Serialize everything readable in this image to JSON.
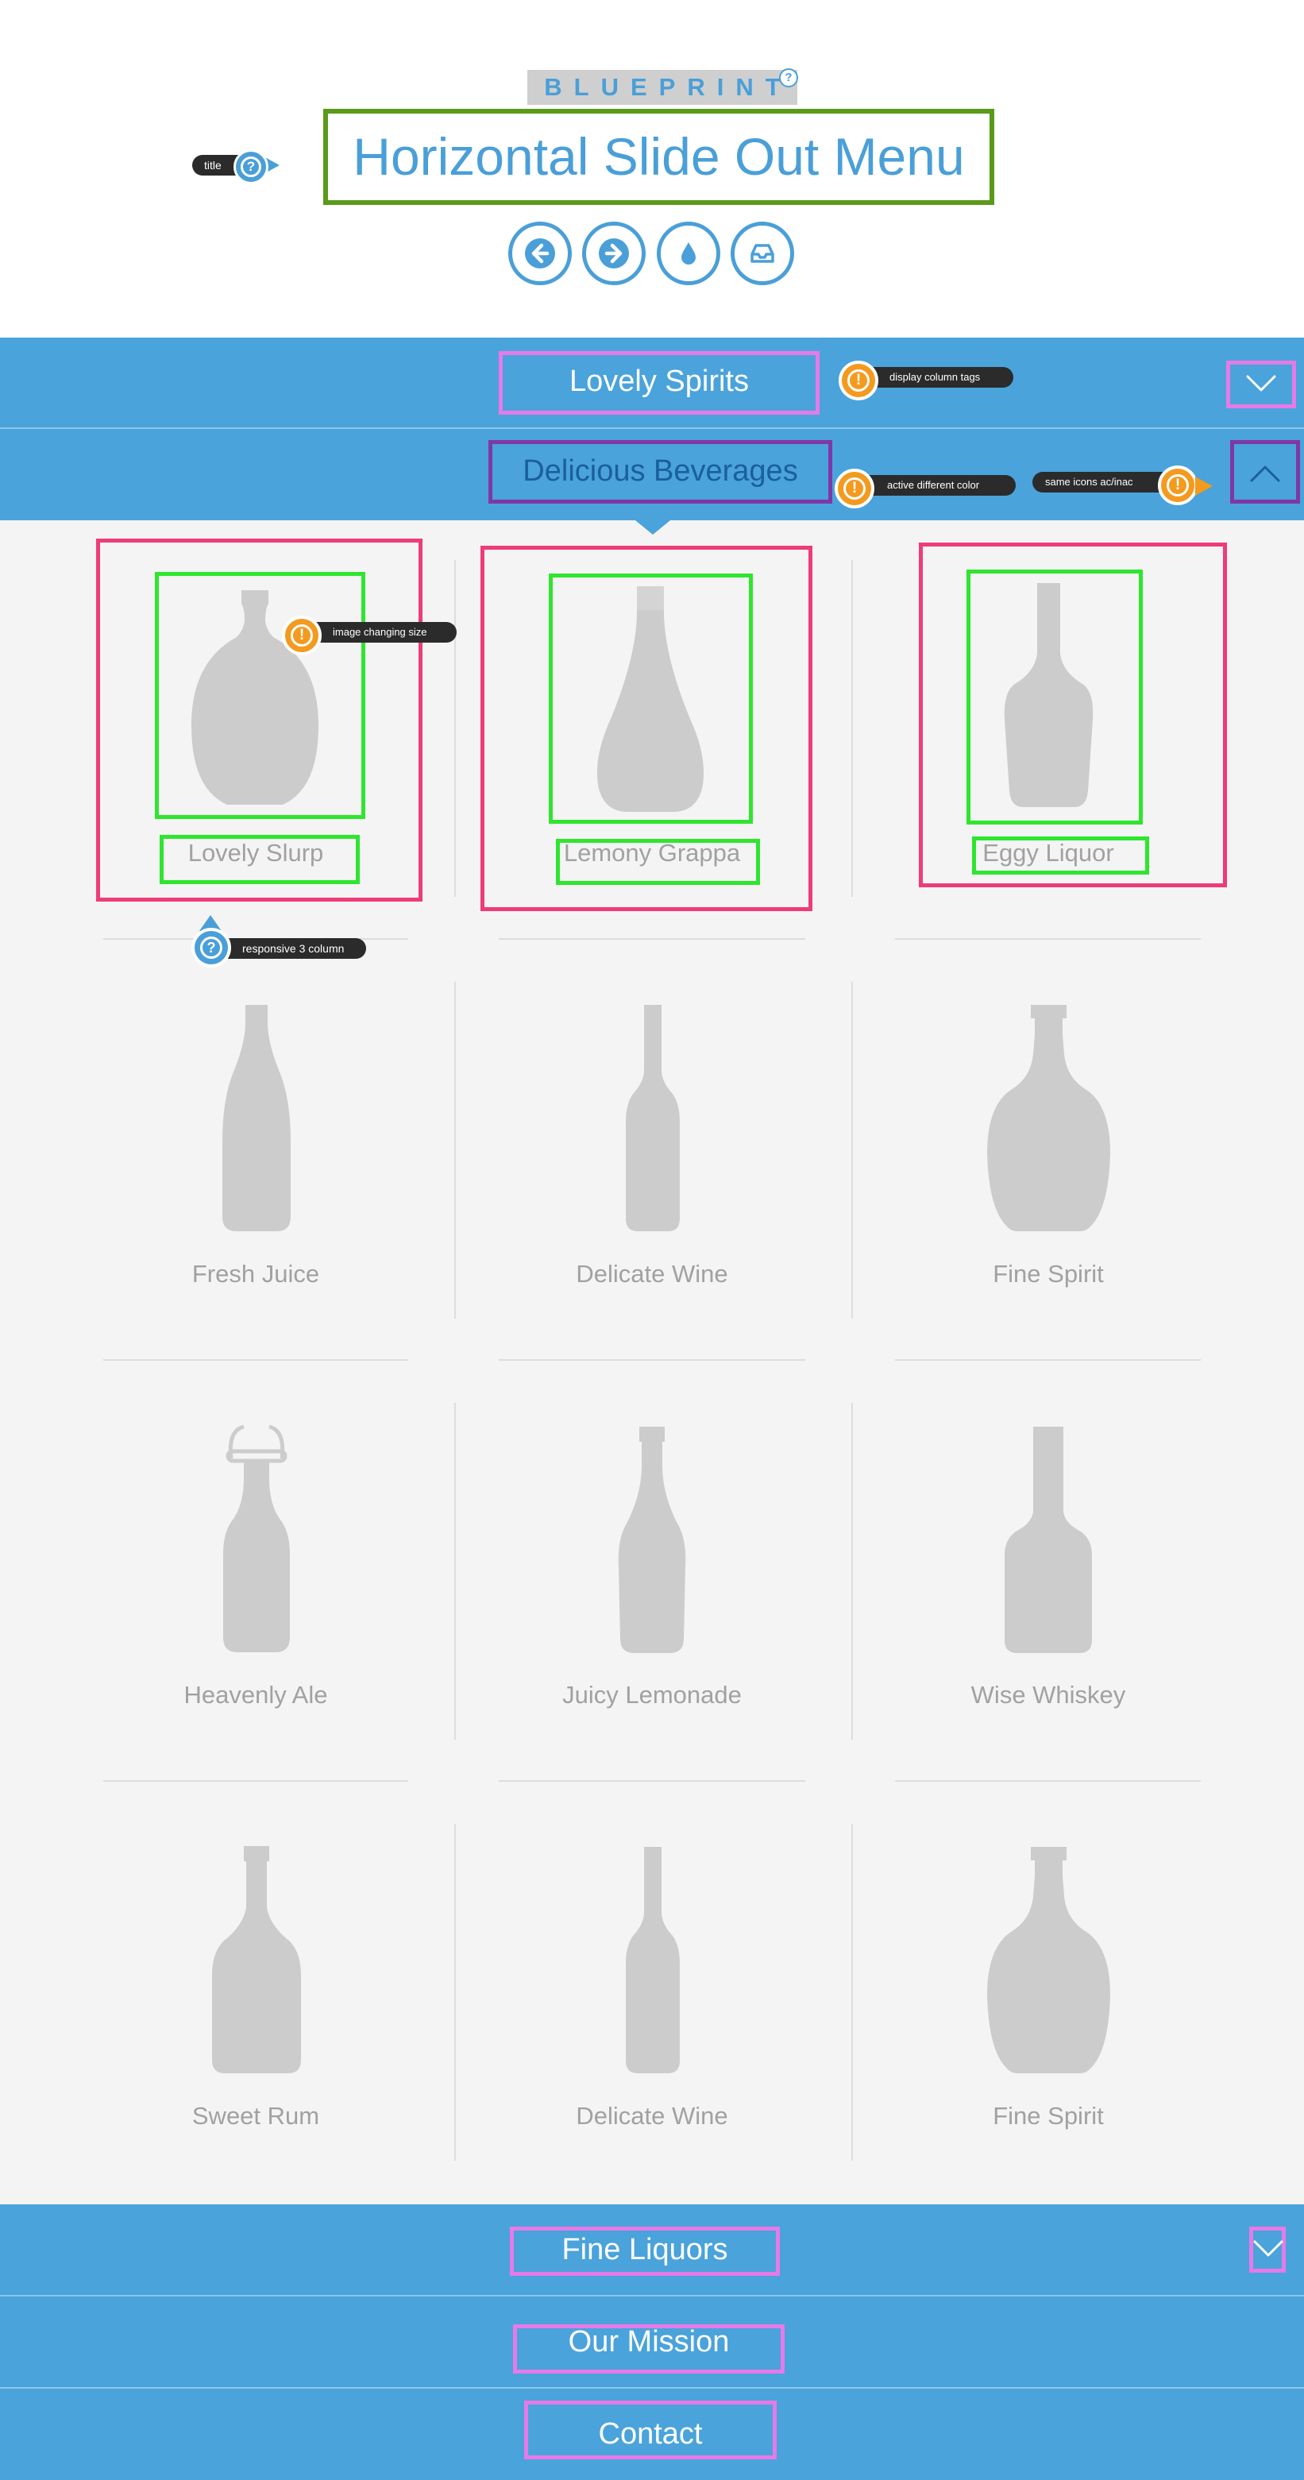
{
  "header": {
    "brand": "BLUEPRINT",
    "brand_help": "?",
    "title": "Horizontal Slide Out Menu",
    "title_tag": "title",
    "nav_icons": [
      "arrow-left-icon",
      "arrow-right-icon",
      "drop-icon",
      "inbox-icon"
    ]
  },
  "accordion": {
    "lovely_spirits": {
      "label": "Lovely Spirits",
      "note": "display column tags"
    },
    "delicious_beverages": {
      "label": "Delicious Beverages",
      "note": "active different color",
      "icon_note": "same icons ac/inac"
    },
    "fine_liquors": {
      "label": "Fine Liquors"
    },
    "our_mission": {
      "label": "Our Mission"
    },
    "contact": {
      "label": "Contact"
    }
  },
  "annotations": {
    "image_size": "image changing size",
    "responsive": "responsive 3 column",
    "warn_mark": "!",
    "help_mark": "?"
  },
  "products": [
    {
      "name": "Lovely Slurp",
      "shape": "round-flask"
    },
    {
      "name": "Lemony Grappa",
      "shape": "teardrop"
    },
    {
      "name": "Eggy Liquor",
      "shape": "tall-shoulder"
    },
    {
      "name": "Fresh Juice",
      "shape": "juice"
    },
    {
      "name": "Delicate Wine",
      "shape": "wine"
    },
    {
      "name": "Fine Spirit",
      "shape": "decanter"
    },
    {
      "name": "Heavenly Ale",
      "shape": "swing-top"
    },
    {
      "name": "Juicy Lemonade",
      "shape": "soda"
    },
    {
      "name": "Wise Whiskey",
      "shape": "square-neck"
    },
    {
      "name": "Sweet Rum",
      "shape": "rum"
    },
    {
      "name": "Delicate Wine",
      "shape": "wine"
    },
    {
      "name": "Fine Spirit",
      "shape": "decanter"
    }
  ],
  "colors": {
    "accent_blue": "#4aa3da",
    "active_text": "#1a5f9e",
    "bottle_gray": "#cccccc",
    "label_gray": "#a1a1a1",
    "annotation_pink": "#e67ae8",
    "annotation_purple": "#7f37a8",
    "annotation_green": "#2fe52f",
    "annotation_red": "#ee3c78",
    "annotation_orange": "#f39a1f"
  }
}
